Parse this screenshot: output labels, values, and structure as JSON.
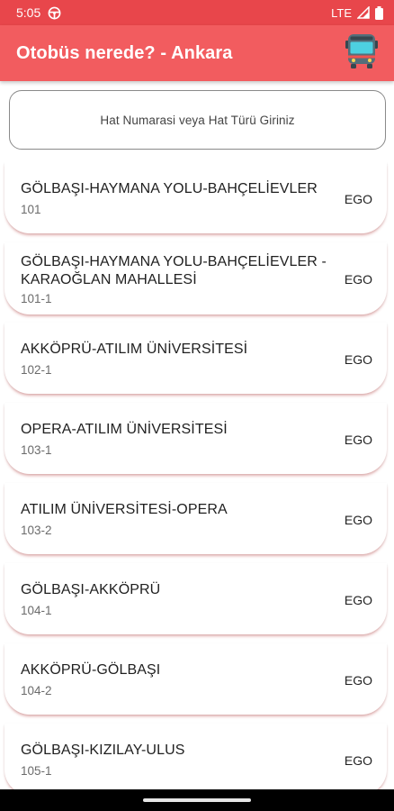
{
  "status_bar": {
    "time": "5:05",
    "network": "LTE"
  },
  "app_bar": {
    "title": "Otobüs nerede? - Ankara",
    "icon": "bus-icon"
  },
  "search": {
    "placeholder": "Hat Numarasi veya Hat Türü Giriniz"
  },
  "routes": [
    {
      "name": "GÖLBAŞI-HAYMANA YOLU-BAHÇELİEVLER",
      "code": "101",
      "operator": "EGO"
    },
    {
      "name": "GÖLBAŞI-HAYMANA YOLU-BAHÇELİEVLER -KARAOĞLAN MAHALLESİ",
      "code": "101-1",
      "operator": "EGO"
    },
    {
      "name": "AKKÖPRÜ-ATILIM ÜNİVERSİTESİ",
      "code": "102-1",
      "operator": "EGO"
    },
    {
      "name": "OPERA-ATILIM ÜNİVERSİTESİ",
      "code": "103-1",
      "operator": "EGO"
    },
    {
      "name": "ATILIM ÜNİVERSİTESİ-OPERA",
      "code": "103-2",
      "operator": "EGO"
    },
    {
      "name": "GÖLBAŞI-AKKÖPRÜ",
      "code": "104-1",
      "operator": "EGO"
    },
    {
      "name": "AKKÖPRÜ-GÖLBAŞI",
      "code": "104-2",
      "operator": "EGO"
    },
    {
      "name": "GÖLBAŞI-KIZILAY-ULUS",
      "code": "105-1",
      "operator": "EGO"
    }
  ],
  "colors": {
    "status_bar": "#e8464b",
    "app_bar": "#f25c5f",
    "card_shadow": "#c85a5a"
  }
}
